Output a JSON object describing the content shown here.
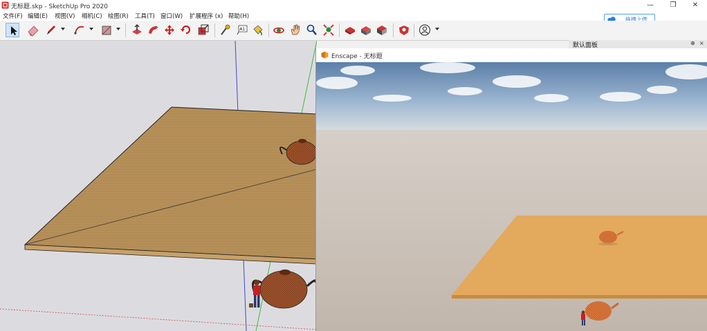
{
  "window": {
    "title": "无标题.skp - SketchUp Pro 2020",
    "minimize": "—",
    "restore": "❐",
    "close": "✕"
  },
  "menu": [
    "文件(F)",
    "编辑(E)",
    "视图(V)",
    "相机(C)",
    "绘图(R)",
    "工具(T)",
    "窗口(W)",
    "扩展程序 (x)",
    "帮助(H)"
  ],
  "upload": {
    "label": "拖拽上传"
  },
  "toolbar": {
    "tools": [
      "select-tool",
      "eraser-tool",
      "pencil-tool",
      "arc-tool",
      "shape-tool",
      "push-pull-tool",
      "follow-me-tool",
      "move-tool",
      "rotate-tool",
      "scale-tool",
      "tape-measure-tool",
      "text-tool",
      "paint-bucket-tool",
      "orbit-tool",
      "pan-tool",
      "zoom-tool",
      "zoom-extents-tool",
      "3d-warehouse-tool",
      "extension-warehouse-tool",
      "layout-tool",
      "extension-manager-tool",
      "account-tool"
    ],
    "text_tool_label": "A1"
  },
  "panel": {
    "title": "默认面板",
    "pin": "⊕",
    "close": "×"
  },
  "enscape": {
    "title": "Enscape - 无标题"
  },
  "colors": {
    "accent": "#2f7fd8",
    "sky_top": "#5b7fa8",
    "ground": "#c9c0b7",
    "wood": "#b68f58",
    "wood_render": "#e3a95c"
  }
}
